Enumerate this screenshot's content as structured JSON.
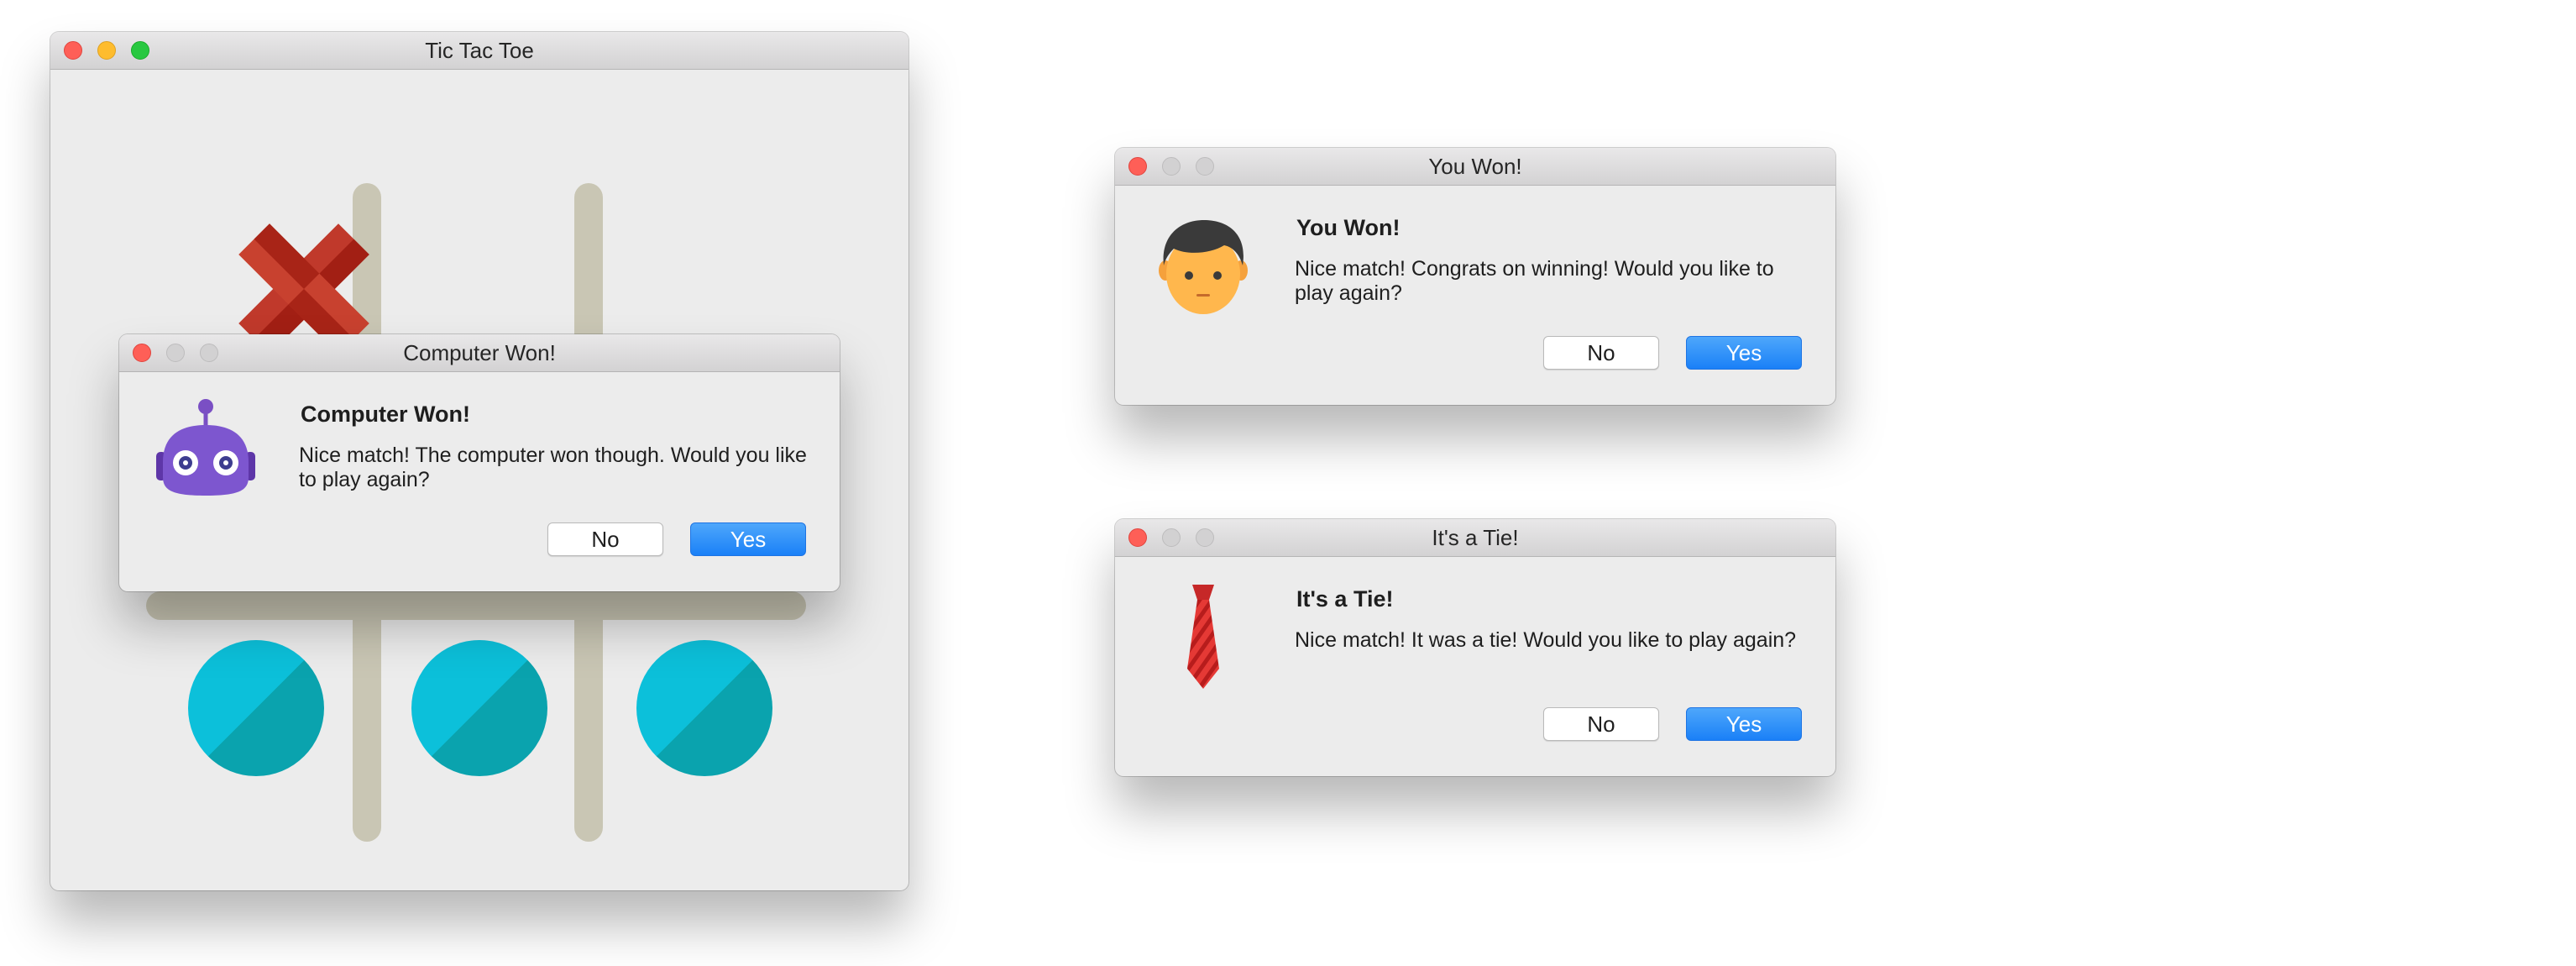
{
  "game_window": {
    "title": "Tic Tac Toe",
    "board": {
      "cells": [
        "X",
        "",
        "",
        "",
        "",
        "",
        "O",
        "O",
        "O"
      ]
    }
  },
  "computer_won_dialog": {
    "title": "Computer Won!",
    "heading": "Computer Won!",
    "message": "Nice match! The computer won though. Would you like to play again?",
    "no_label": "No",
    "yes_label": "Yes",
    "icon": "robot-icon"
  },
  "you_won_dialog": {
    "title": "You Won!",
    "heading": "You Won!",
    "message": "Nice match! Congrats on winning! Would you like to play again?",
    "no_label": "No",
    "yes_label": "Yes",
    "icon": "man-face-icon"
  },
  "tie_dialog": {
    "title": "It's a Tie!",
    "heading": "It's a Tie!",
    "message": "Nice match! It was a tie! Would you like to play again?",
    "no_label": "No",
    "yes_label": "Yes",
    "icon": "necktie-icon"
  },
  "colors": {
    "x_mark": "#c0392b",
    "o_mark": "#0cc0da",
    "board_lines": "#c9c6b4",
    "yes_button": "#1a80f7",
    "window_bg": "#ececec"
  }
}
